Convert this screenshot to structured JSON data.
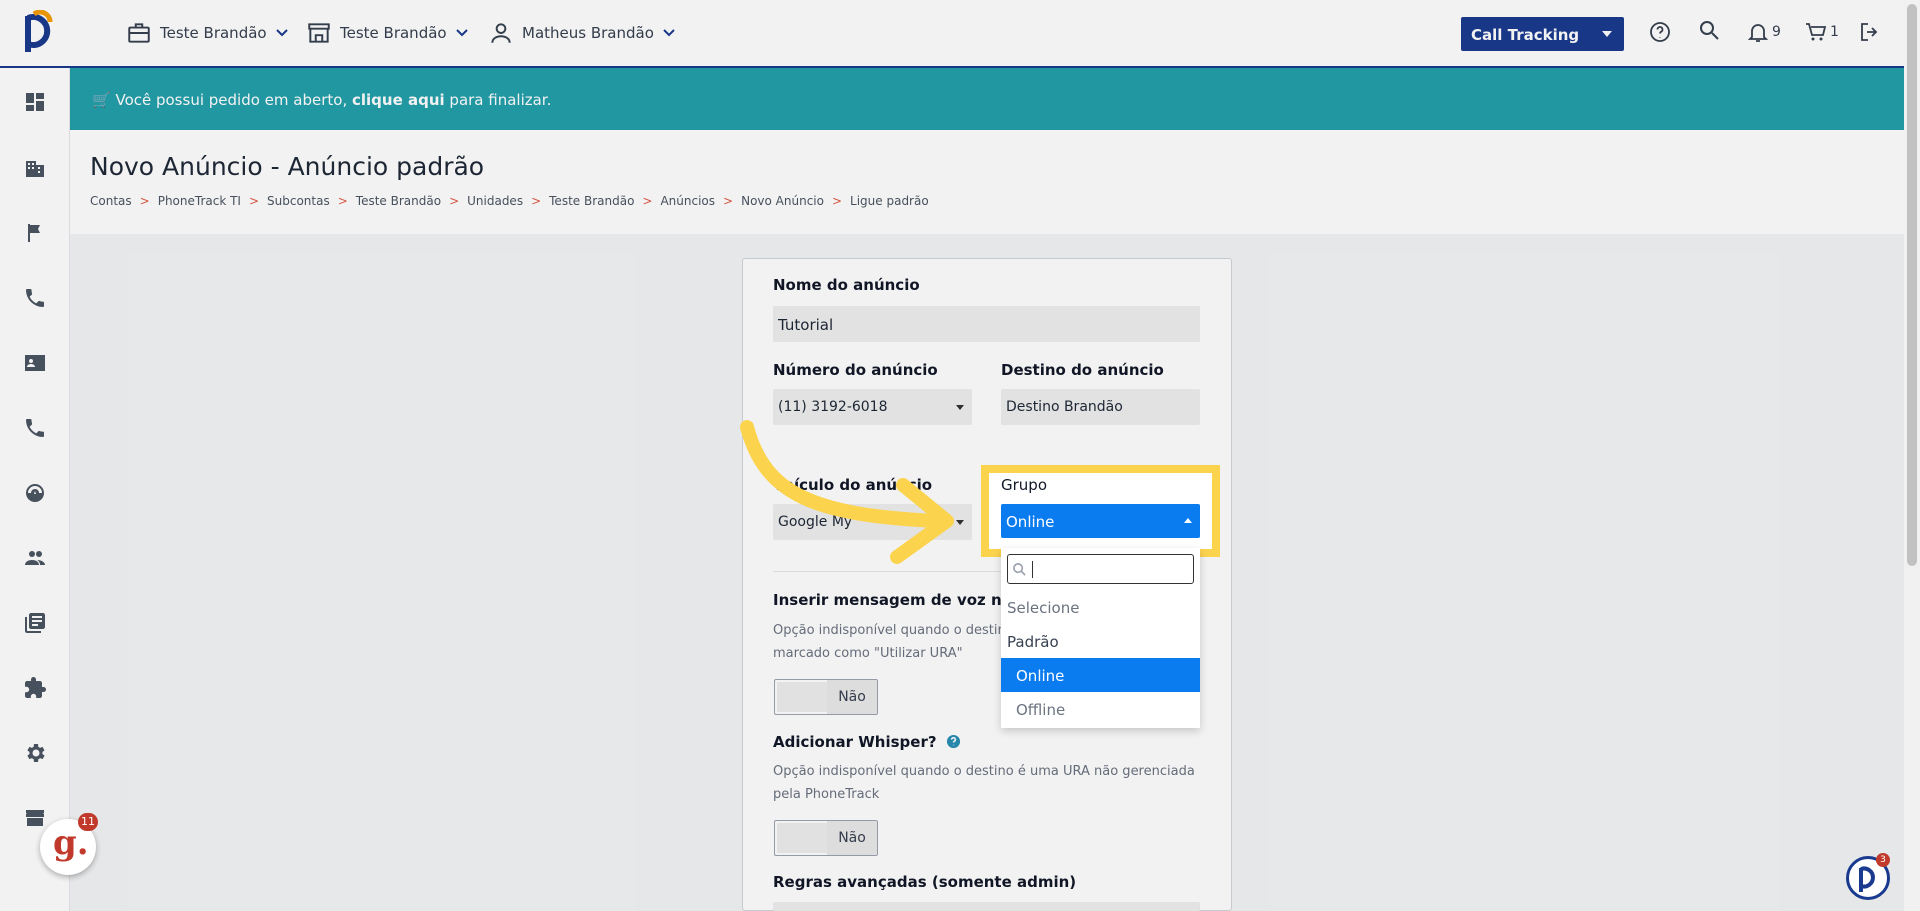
{
  "header": {
    "menus": [
      {
        "label": "Teste Brandão",
        "icon": "briefcase-icon"
      },
      {
        "label": "Teste Brandão",
        "icon": "store-icon"
      },
      {
        "label": "Matheus Brandão",
        "icon": "user-icon"
      }
    ],
    "product_select": "Call Tracking",
    "notifications_count": "9",
    "cart_count": "1"
  },
  "banner": {
    "prefix": "Você possui pedido em aberto, ",
    "link": "clique aqui",
    "suffix": " para finalizar."
  },
  "page": {
    "title": "Novo Anúncio - Anúncio padrão",
    "breadcrumb": [
      "Contas",
      "PhoneTrack TI",
      "Subcontas",
      "Teste Brandão",
      "Unidades",
      "Teste Brandão",
      "Anúncios",
      "Novo Anúncio",
      "Ligue padrão"
    ]
  },
  "form": {
    "name_label": "Nome do anúncio",
    "name_value": "Tutorial",
    "number_label": "Número do anúncio",
    "number_value": "(11) 3192-6018",
    "dest_label": "Destino do anúncio",
    "dest_value": "Destino Brandão",
    "vehicle_label": "Veículo do anúncio",
    "vehicle_value": "Google My",
    "group_label": "Grupo",
    "group_value": "Online",
    "voice_label": "Inserir mensagem de voz na ch",
    "voice_help_1": "Opção indisponível quando o destin",
    "voice_help_2": "marcado como \"Utilizar URA\"",
    "voice_toggle": "Não",
    "whisper_label": "Adicionar Whisper?",
    "whisper_help_1": "Opção indisponível quando o destino é uma URA não gerenciada",
    "whisper_help_2": "pela PhoneTrack",
    "whisper_toggle": "Não",
    "advanced_label": "Regras avançadas (somente admin)"
  },
  "dropdown": {
    "placeholder_option": "Selecione",
    "group": "Padrão",
    "options": [
      "Online",
      "Offline"
    ],
    "selected": "Online"
  },
  "widgets": {
    "g_badge": "11",
    "p_badge": "3"
  },
  "colors": {
    "brand_navy": "#1a3a8f",
    "banner_teal": "#23a0ab",
    "select_blue": "#0b7bf0",
    "highlight_yellow": "#fcd34d"
  }
}
